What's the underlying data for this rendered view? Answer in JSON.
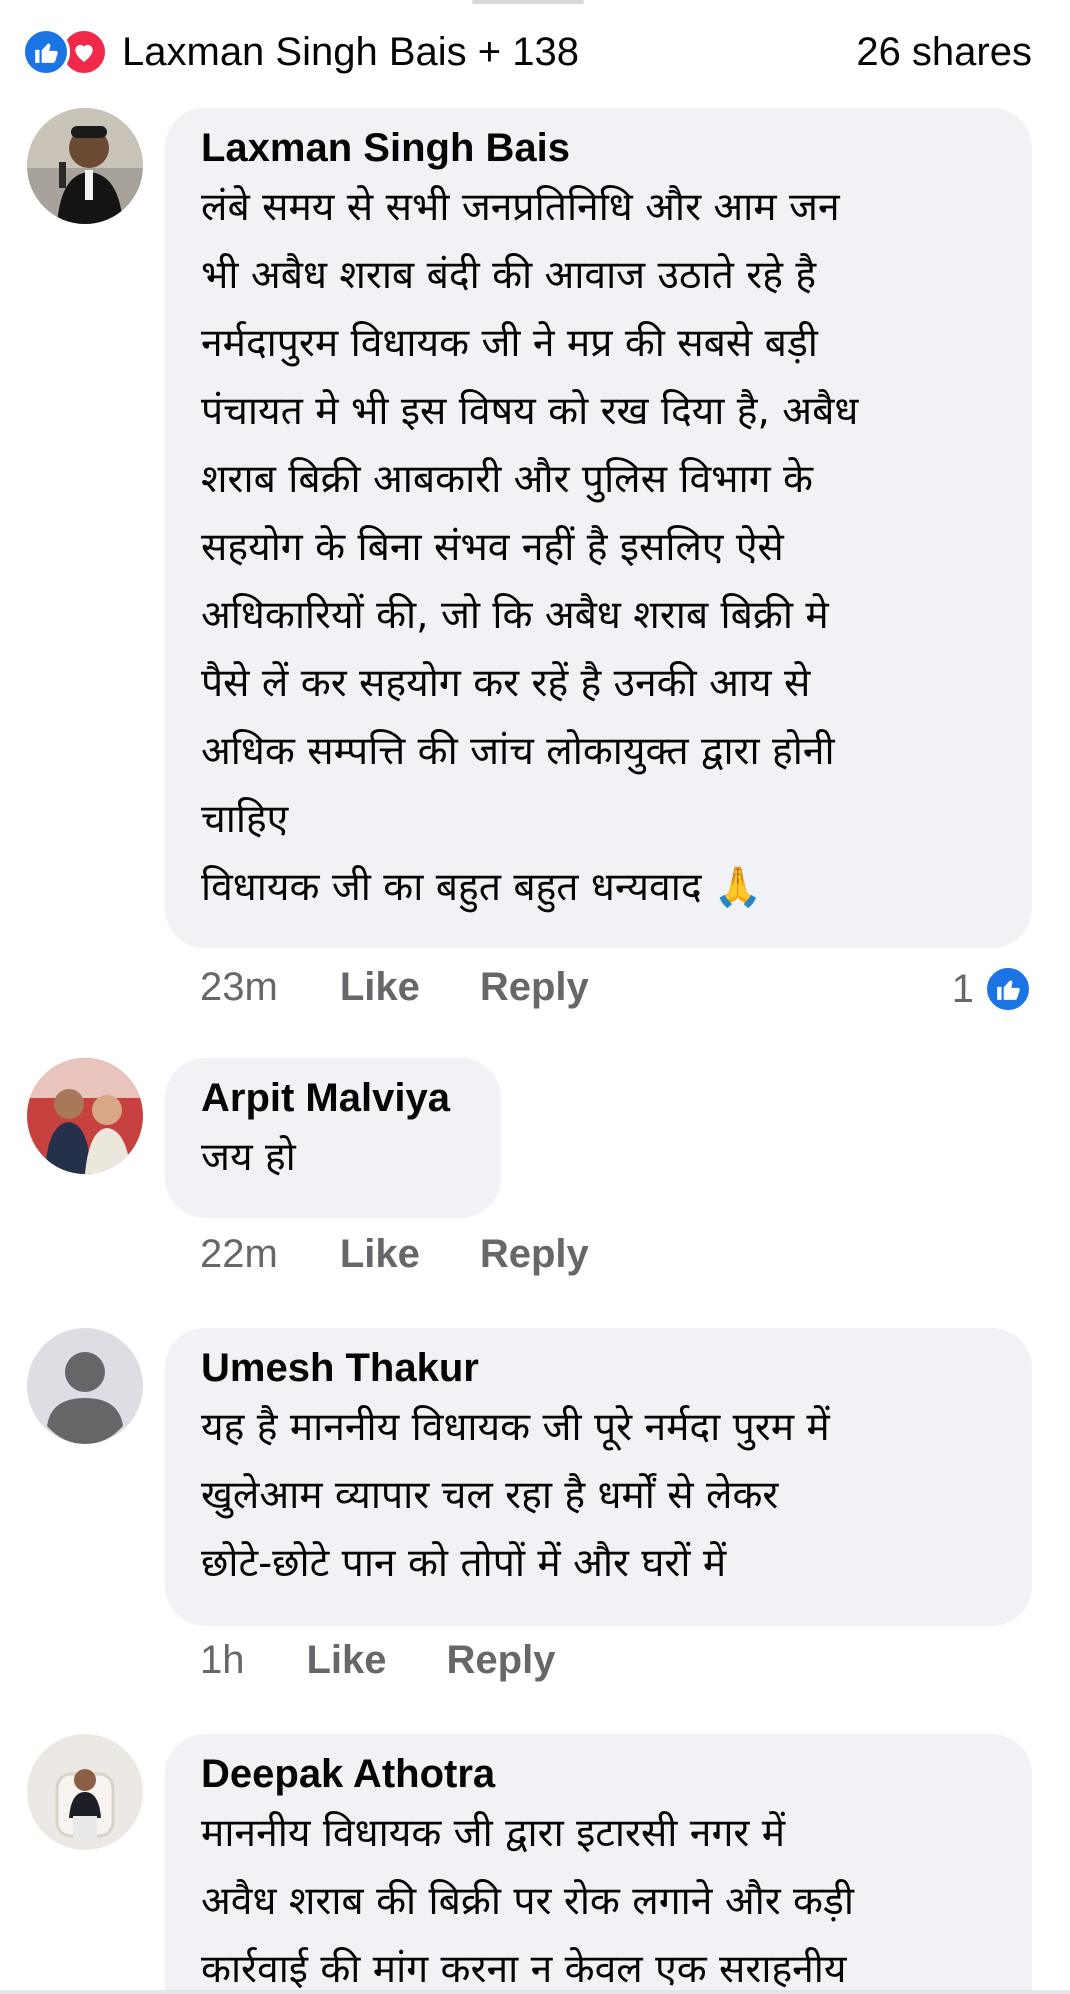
{
  "reactions": {
    "names": "Laxman Singh Bais + 138",
    "shares": "26 shares",
    "icons": [
      "like-icon",
      "love-icon"
    ],
    "colors": {
      "like": "#1b74e4",
      "love": "#f0284a"
    }
  },
  "comments": [
    {
      "author": "Laxman Singh Bais",
      "lines": [
        "लंबे समय से सभी जनप्रतिनिधि और आम जन",
        "भी अबैध शराब बंदी की आवाज उठाते रहे है",
        "नर्मदापुरम विधायक जी ने मप्र की सबसे बड़ी",
        "पंचायत मे भी इस विषय को रख दिया है,  अबैध",
        "शराब बिक्री आबकारी और पुलिस विभाग के",
        "सहयोग के बिना संभव नहीं है इसलिए ऐसे",
        "अधिकारियों की, जो कि अबैध शराब बिक्री मे",
        "पैसे लें कर सहयोग कर रहें है उनकी आय से",
        "अधिक सम्पत्ति की जांच लोकायुक्त द्वारा होनी",
        "चाहिए",
        "विधायक जी का बहुत बहुत धन्यवाद 🙏"
      ],
      "time": "23m",
      "like": "Like",
      "reply": "Reply",
      "reaction_count": "1"
    },
    {
      "author": "Arpit Malviya",
      "lines": [
        "जय हो"
      ],
      "time": "22m",
      "like": "Like",
      "reply": "Reply"
    },
    {
      "author": "Umesh Thakur",
      "lines": [
        "यह है माननीय विधायक जी पूरे नर्मदा पुरम में",
        "खुलेआम व्यापार चल रहा है धर्मों से लेकर",
        "छोटे-छोटे पान को तोपों में और घरों में"
      ],
      "time": "1h",
      "like": "Like",
      "reply": "Reply"
    },
    {
      "author": "Deepak Athotra",
      "lines": [
        "माननीय विधायक जी द्वारा इटारसी नगर में",
        "अवैध शराब की बिक्री पर रोक लगाने और कड़ी",
        "कार्रवाई की मांग करना न केवल एक सराहनीय"
      ]
    }
  ]
}
